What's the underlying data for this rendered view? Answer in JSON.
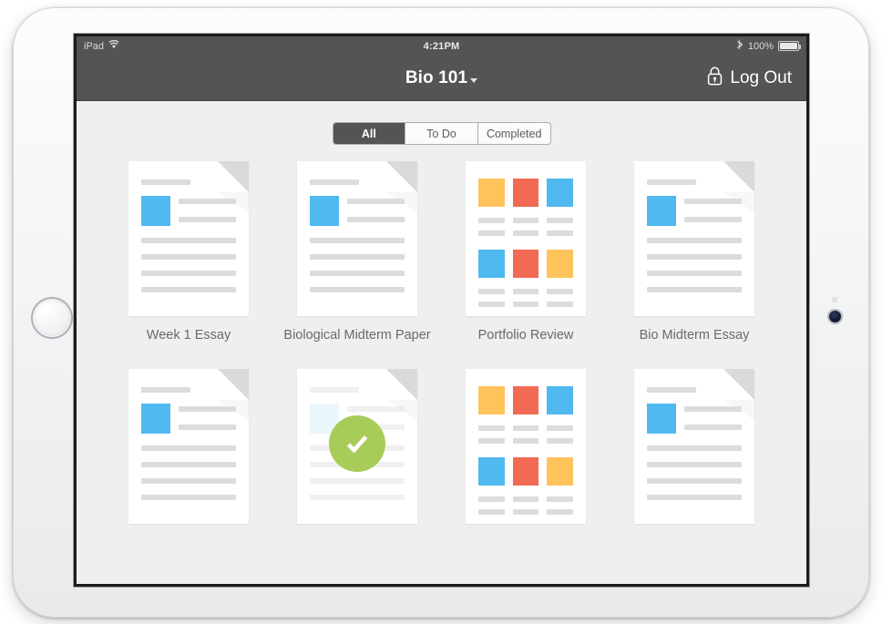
{
  "device": {
    "name": "iPad",
    "orientation": "landscape",
    "home_button": "home-button",
    "camera": "front-camera"
  },
  "status_bar": {
    "device_label": "iPad",
    "wifi_icon": "wifi-icon",
    "clock": "4:21PM",
    "bluetooth_icon": "bluetooth-icon",
    "battery_percent": "100%",
    "battery_icon": "battery-full-icon",
    "background_color": "#555453",
    "text_color": "#d9d9d9"
  },
  "nav_bar": {
    "title": "Bio 101",
    "title_caret_icon": "chevron-down-icon",
    "logout_label": "Log Out",
    "logout_icon": "lock-icon",
    "background_color": "#555453"
  },
  "filter_tabs": {
    "selected": "All",
    "options": [
      {
        "label": "All",
        "selected": true
      },
      {
        "label": "To Do",
        "selected": false
      },
      {
        "label": "Completed",
        "selected": false
      }
    ]
  },
  "palette": {
    "screen_background": "#efefef",
    "page_white": "#ffffff",
    "placeholder_gray": "#dcdcdc",
    "fold_gray": "#d8dadc",
    "blue": "#4fb9f0",
    "pale_blue": "#cfe9f9",
    "red": "#f06a54",
    "yellow": "#ffc35c",
    "green": "#a8cc58"
  },
  "assignments": [
    {
      "title": "Week 1 Essay",
      "type": "document",
      "folded_corner": true,
      "completed": false,
      "thumb_color": "#4fb9f0",
      "body_lines": 4
    },
    {
      "title": "Biological Midterm Paper",
      "type": "document",
      "folded_corner": true,
      "completed": false,
      "thumb_color": "#4fb9f0",
      "body_lines": 4
    },
    {
      "title": "Portfolio Review",
      "type": "portfolio",
      "folded_corner": false,
      "completed": false,
      "tiles": [
        [
          "#ffc35c",
          "#f06a54",
          "#4fb9f0"
        ],
        [
          "#4fb9f0",
          "#f06a54",
          "#ffc35c"
        ]
      ]
    },
    {
      "title": "Bio Midterm Essay",
      "type": "document",
      "folded_corner": true,
      "completed": false,
      "thumb_color": "#4fb9f0",
      "body_lines": 4
    },
    {
      "title": "",
      "type": "document",
      "folded_corner": true,
      "completed": false,
      "thumb_color": "#4fb9f0",
      "body_lines": 4
    },
    {
      "title": "",
      "type": "document",
      "folded_corner": true,
      "completed": true,
      "completed_badge_icon": "check-circle-icon",
      "thumb_color": "#cfe9f9",
      "body_lines": 4
    },
    {
      "title": "",
      "type": "portfolio",
      "folded_corner": false,
      "completed": false,
      "tiles": [
        [
          "#ffc35c",
          "#f06a54",
          "#4fb9f0"
        ],
        [
          "#4fb9f0",
          "#f06a54",
          "#ffc35c"
        ]
      ]
    },
    {
      "title": "",
      "type": "document",
      "folded_corner": true,
      "completed": false,
      "thumb_color": "#4fb9f0",
      "body_lines": 4
    }
  ]
}
